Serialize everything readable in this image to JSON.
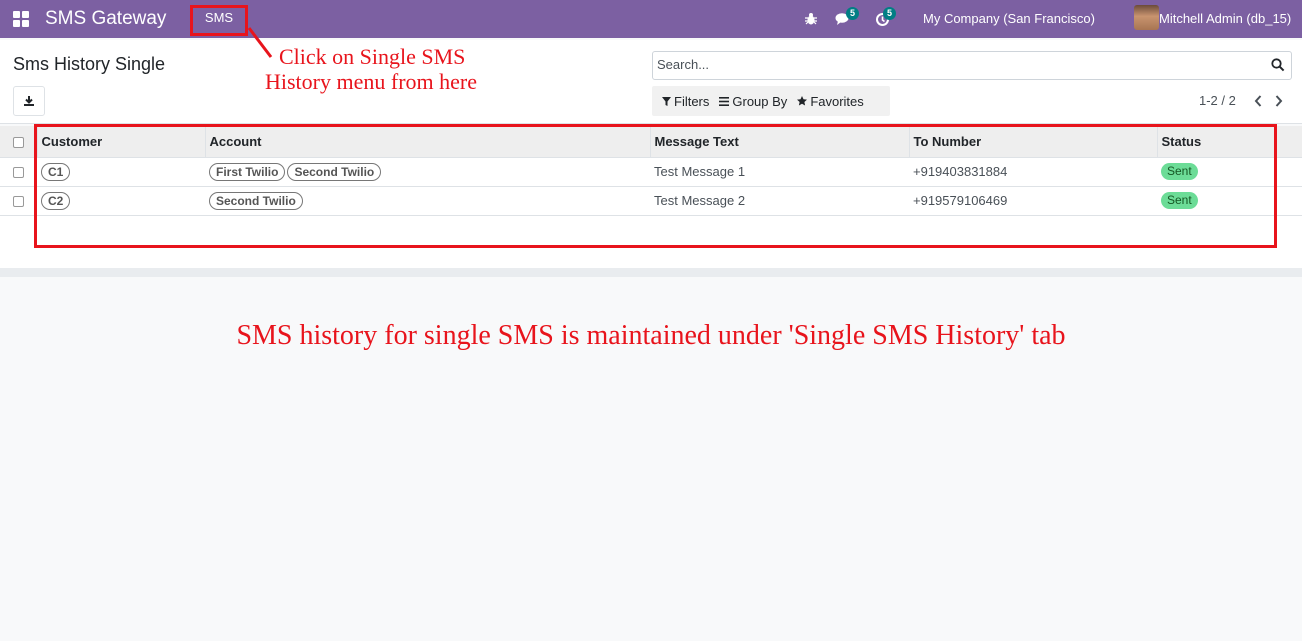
{
  "navbar": {
    "app_title": "SMS Gateway",
    "menu_sms": "SMS",
    "chat_badge": "5",
    "activity_badge": "5",
    "company": "My Company (San Francisco)",
    "user": "Mitchell Admin (db_15)"
  },
  "control_panel": {
    "breadcrumb": "Sms History Single",
    "search_placeholder": "Search...",
    "filters_label": "Filters",
    "group_by_label": "Group By",
    "favorites_label": "Favorites",
    "pager": "1-2 / 2"
  },
  "table": {
    "columns": [
      "Customer",
      "Account",
      "Message Text",
      "To Number",
      "Status"
    ],
    "rows": [
      {
        "customer": "C1",
        "accounts": [
          "First Twilio",
          "Second Twilio"
        ],
        "message": "Test Message 1",
        "to_number": "+919403831884",
        "status": "Sent"
      },
      {
        "customer": "C2",
        "accounts": [
          "Second Twilio"
        ],
        "message": "Test Message 2",
        "to_number": "+919579106469",
        "status": "Sent"
      }
    ]
  },
  "annotations": {
    "menu_hint_line1": "Click on Single SMS",
    "menu_hint_line2": "History menu from here",
    "caption": "SMS history for single SMS is maintained under 'Single SMS History' tab"
  },
  "colors": {
    "navbar": "#7c60a2",
    "annotation": "#e8141c",
    "status_sent": "#6cdc97",
    "badge": "#017e84"
  },
  "icons": {
    "apps": "apps-grid-icon",
    "bug": "bug-icon",
    "chat": "chat-icon",
    "activity": "clock-icon",
    "download": "download-icon",
    "search": "search-icon",
    "filter": "filter-icon",
    "group_by": "list-icon",
    "favorites": "star-icon",
    "prev": "chevron-left-icon",
    "next": "chevron-right-icon"
  }
}
